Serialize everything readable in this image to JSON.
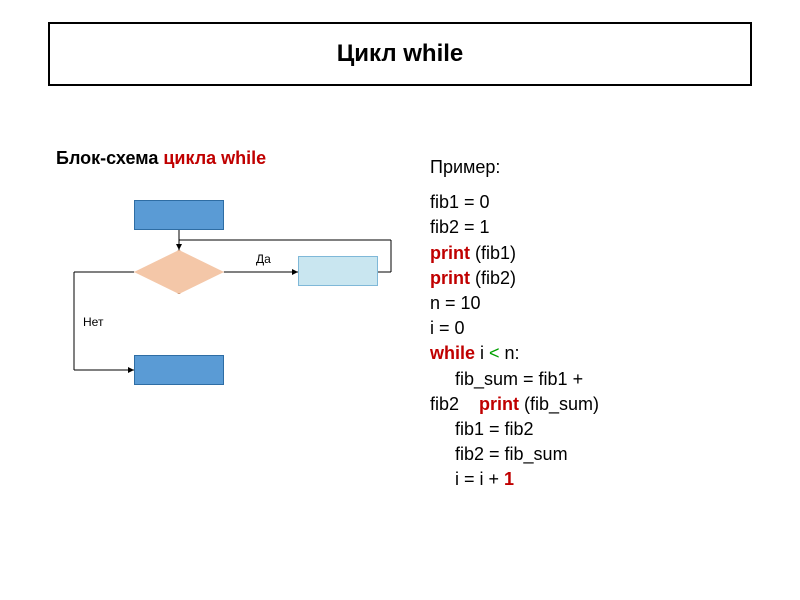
{
  "title": "Цикл while",
  "subtitle": {
    "black1": "Блок-схема ",
    "red": "цикла while"
  },
  "flowchart": {
    "label_yes": "Да",
    "label_no": "Нет"
  },
  "example": {
    "title": "Пример:",
    "lines": [
      {
        "parts": [
          {
            "t": "fib1 = 0"
          }
        ]
      },
      {
        "parts": [
          {
            "t": "fib2 = 1"
          }
        ]
      },
      {
        "parts": [
          {
            "t": "print",
            "c": "kw-red"
          },
          {
            "t": " (fib1)"
          }
        ]
      },
      {
        "parts": [
          {
            "t": "print",
            "c": "kw-red"
          },
          {
            "t": " (fib2)"
          }
        ]
      },
      {
        "parts": [
          {
            "t": "n = 10"
          }
        ]
      },
      {
        "parts": [
          {
            "t": "i = 0"
          }
        ]
      },
      {
        "parts": [
          {
            "t": "while",
            "c": "kw-red"
          },
          {
            "t": " i "
          },
          {
            "t": "<",
            "c": "kw-green"
          },
          {
            "t": " n:"
          }
        ]
      },
      {
        "parts": [
          {
            "t": "     fib_sum = fib1 + "
          }
        ]
      },
      {
        "parts": [
          {
            "t": "fib2    "
          },
          {
            "t": "print",
            "c": "kw-red"
          },
          {
            "t": " (fib_sum)"
          }
        ]
      },
      {
        "parts": [
          {
            "t": "     fib1 = fib2"
          }
        ]
      },
      {
        "parts": [
          {
            "t": "     fib2 = fib_sum"
          }
        ]
      },
      {
        "parts": [
          {
            "t": "     i = i + "
          },
          {
            "t": "1",
            "c": "kw-red"
          }
        ]
      }
    ]
  }
}
